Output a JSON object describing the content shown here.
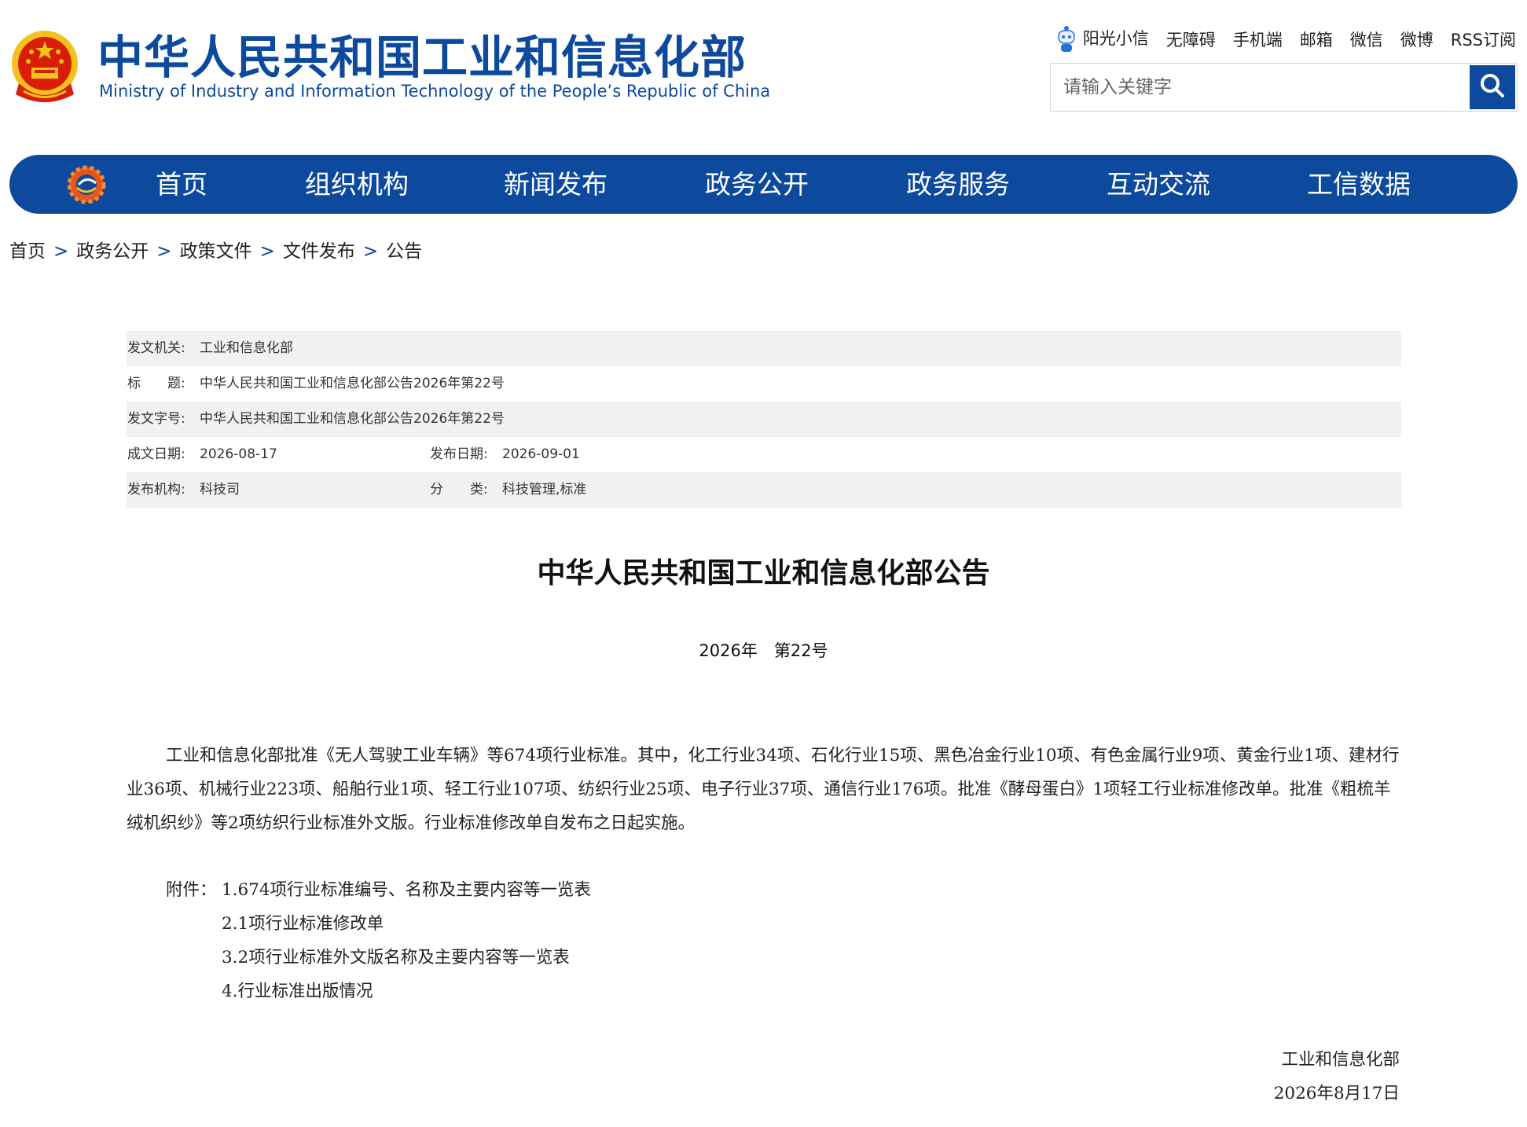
{
  "header": {
    "title_cn": "中华人民共和国工业和信息化部",
    "title_en": "Ministry of Industry and Information Technology of the People’s Republic of China",
    "top_links": [
      "阳光小信",
      "无障碍",
      "手机端",
      "邮箱",
      "微信",
      "微博",
      "RSS订阅"
    ],
    "search_placeholder": "请输入关键字"
  },
  "nav": {
    "items": [
      "首页",
      "组织机构",
      "新闻发布",
      "政务公开",
      "政务服务",
      "互动交流",
      "工信数据"
    ]
  },
  "breadcrumb": [
    "首页",
    "政务公开",
    "政策文件",
    "文件发布",
    "公告"
  ],
  "meta": {
    "issuer_label": "发文机关:",
    "issuer": "工业和信息化部",
    "title_label": "标　　题:",
    "title": "中华人民共和国工业和信息化部公告2026年第22号",
    "doc_no_label": "发文字号:",
    "doc_no": "中华人民共和国工业和信息化部公告2026年第22号",
    "created_label": "成文日期:",
    "created": "2026-08-17",
    "published_label": "发布日期:",
    "published": "2026-09-01",
    "org_label": "发布机构:",
    "org": "科技司",
    "category_label": "分　　类:",
    "category": "科技管理,标准"
  },
  "document": {
    "title": "中华人民共和国工业和信息化部公告",
    "number": "2026年　第22号",
    "body": "工业和信息化部批准《无人驾驶工业车辆》等674项行业标准。其中，化工行业34项、石化行业15项、黑色冶金行业10项、有色金属行业9项、黄金行业1项、建材行业36项、机械行业223项、船舶行业1项、轻工行业107项、纺织行业25项、电子行业37项、通信行业176项。批准《酵母蛋白》1项轻工行业标准修改单。批准《粗梳羊绒机织纱》等2项纺织行业标准外文版。行业标准修改单自发布之日起实施。",
    "attachments_label": "附件：",
    "attachments": [
      "1.674项行业标准编号、名称及主要内容等一览表",
      "2.1项行业标准修改单",
      "3.2项行业标准外文版名称及主要内容等一览表",
      "4.行业标准出版情况"
    ],
    "signature_org": "工业和信息化部",
    "signature_date": "2026年8月17日"
  },
  "colors": {
    "brand_blue": "#0d4a9e",
    "meta_row_shade": "#f1f1f1",
    "emblem_red": "#d81e06",
    "emblem_gold": "#f5c21b"
  }
}
